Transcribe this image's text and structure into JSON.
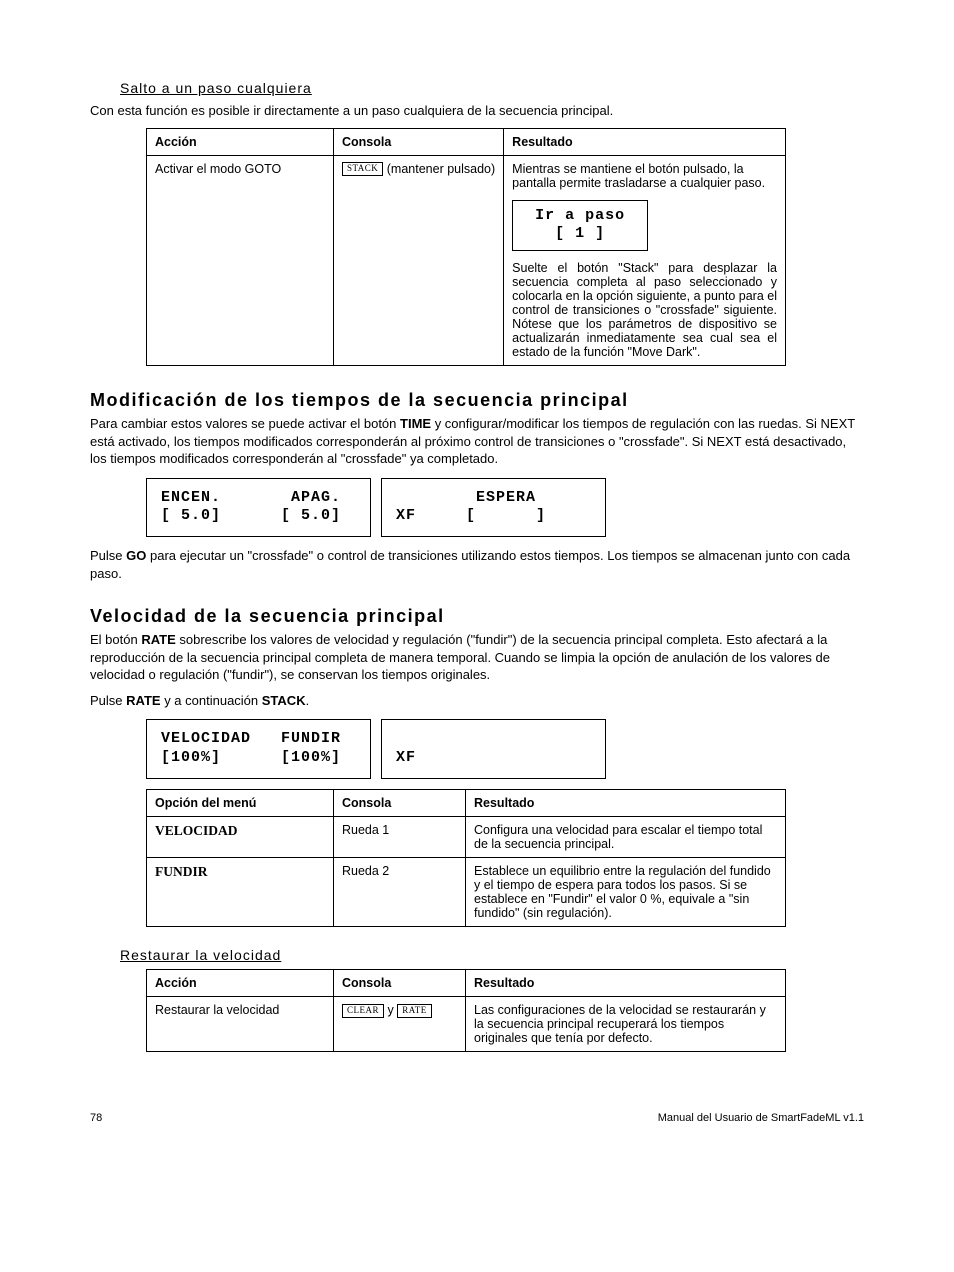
{
  "sections": {
    "salto": {
      "title": "Salto a un paso cualquiera",
      "desc": "Con esta función es posible ir directamente a un paso cualquiera de la secuencia principal.",
      "table": {
        "headers": [
          "Acción",
          "Consola",
          "Resultado"
        ],
        "row": {
          "accion": "Activar el modo GOTO",
          "consola_btn": "STACK",
          "consola_text": " (mantener pulsado)",
          "res1": "Mientras se mantiene el botón pulsado, la pantalla permite trasladarse a cualquier paso.",
          "lcd_l1": "Ir a paso",
          "lcd_l2": "[ 1 ]",
          "res2": "Suelte el botón \"Stack\" para desplazar la secuencia completa al paso seleccionado y colocarla en la opción siguiente, a punto para el control de transiciones o \"crossfade\" siguiente. Nótese que los parámetros de dispositivo se actualizarán inmediatamente sea cual sea el estado de la función \"Move Dark\"."
        }
      }
    },
    "modif": {
      "title": "Modificación de los tiempos de la secuencia principal",
      "desc_pre": "Para cambiar estos valores se puede activar el botón ",
      "desc_bold": "TIME",
      "desc_post": " y configurar/modificar los tiempos de regulación con las ruedas. Si NEXT está activado, los tiempos modificados corresponderán al próximo control de transiciones o \"crossfade\". Si NEXT está desactivado, los tiempos modificados corresponderán al \"crossfade\" ya completado.",
      "lcd_left": "ENCEN.       APAG.\n[ 5.0]      [ 5.0]",
      "lcd_right": "        ESPERA\nXF     [      ]",
      "desc2_pre": "Pulse ",
      "desc2_bold": "GO",
      "desc2_post": " para ejecutar un \"crossfade\" o control de transiciones utilizando estos tiempos. Los tiempos se almacenan junto con cada paso."
    },
    "veloc": {
      "title": "Velocidad de la secuencia principal",
      "desc_pre": "El botón ",
      "desc_bold": "RATE",
      "desc_post": " sobrescribe los valores de velocidad y regulación (\"fundir\") de la secuencia principal completa. Esto afectará a la reproducción de la secuencia principal completa de manera temporal. Cuando se limpia la opción de anulación de los valores de velocidad o regulación (\"fundir\"), se conservan los tiempos originales.",
      "desc2_pre": "Pulse ",
      "desc2_b1": "RATE",
      "desc2_mid": " y a continuación ",
      "desc2_b2": "STACK",
      "desc2_post": ".",
      "lcd_left": "VELOCIDAD   FUNDIR\n[100%]      [100%]",
      "lcd_right": "\nXF",
      "table": {
        "headers": [
          "Opción del menú",
          "Consola",
          "Resultado"
        ],
        "rows": [
          {
            "opt": "VELOCIDAD",
            "con": "Rueda 1",
            "res": "Configura una velocidad para escalar el tiempo total de la secuencia principal."
          },
          {
            "opt": "FUNDIR",
            "con": "Rueda 2",
            "res": "Establece un equilibrio entre la regulación del fundido y el tiempo de espera para todos los pasos. Si se establece en \"Fundir\" el valor 0 %, equivale a \"sin fundido\" (sin regulación)."
          }
        ]
      }
    },
    "restaurar": {
      "title": "Restaurar la velocidad",
      "table": {
        "headers": [
          "Acción",
          "Consola",
          "Resultado"
        ],
        "row": {
          "accion": "Restaurar la velocidad",
          "btn1": "CLEAR",
          "sep": " y ",
          "btn2": "RATE",
          "res": "Las configuraciones de la velocidad se restaurarán y la secuencia principal recuperará los tiempos originales que tenía por defecto."
        }
      }
    }
  },
  "footer": {
    "page": "78",
    "title": "Manual del Usuario de SmartFadeML v1.1"
  }
}
